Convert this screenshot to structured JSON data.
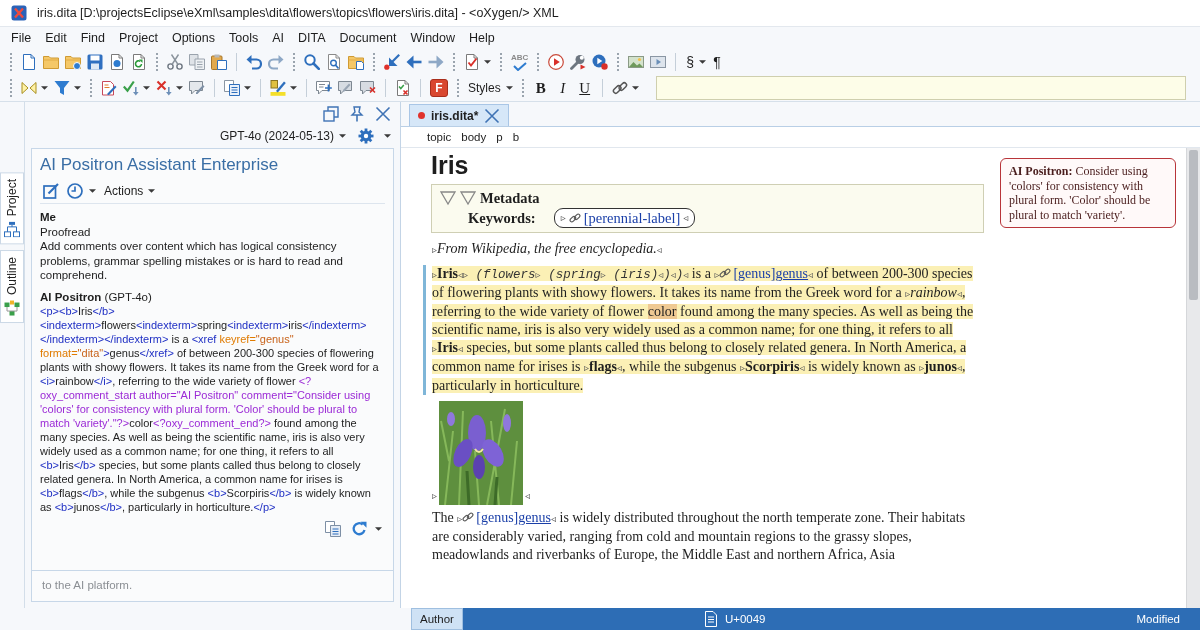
{
  "window": {
    "title": "iris.dita [D:\\projectsEclipse\\eXml\\samples\\dita\\flowers\\topics\\flowers\\iris.dita] - <oXygen/> XML"
  },
  "menu": [
    "File",
    "Edit",
    "Find",
    "Project",
    "Options",
    "Tools",
    "AI",
    "DITA",
    "Document",
    "Window",
    "Help"
  ],
  "toolbar": {
    "spellcheck_label": "ABC",
    "section_sign": "§",
    "pilcrow": "¶",
    "f_label": "F",
    "styles_label": "Styles",
    "format_buttons": [
      "B",
      "I",
      "U"
    ]
  },
  "side_tabs": [
    {
      "label": "Project",
      "selected": false
    },
    {
      "label": "Outline",
      "selected": false
    }
  ],
  "ai_panel": {
    "model": "GPT-4o (2024-05-13)",
    "title": "AI Positron Assistant Enterprise",
    "actions_label": "Actions",
    "messages": [
      {
        "kind": "user",
        "author": "Me",
        "lines": [
          "Proofread",
          "Add comments over content which has logical consistency problems, grammar spelling mistakes or is hard to read and comprehend."
        ]
      },
      {
        "kind": "assistant",
        "author": "AI Positron",
        "model": "(GPT-4o)",
        "code": [
          {
            "kind": "tag",
            "text": "<p><b>"
          },
          {
            "kind": "text",
            "text": "Iris"
          },
          {
            "kind": "tag",
            "text": "</b><indexterm>"
          },
          {
            "kind": "text",
            "text": "flowers"
          },
          {
            "kind": "tag",
            "text": "<indexterm>"
          },
          {
            "kind": "text",
            "text": "spring"
          },
          {
            "kind": "tag",
            "text": "<indexterm>"
          },
          {
            "kind": "text",
            "text": "iris"
          },
          {
            "kind": "tag",
            "text": "</indexterm></indexterm></indexterm>"
          },
          {
            "kind": "text",
            "text": " is a "
          },
          {
            "kind": "tag",
            "text": "<xref "
          },
          {
            "kind": "attr",
            "text": "keyref="
          },
          {
            "kind": "value",
            "text": "\"genus\""
          },
          {
            "kind": "attr",
            "text": " format="
          },
          {
            "kind": "value",
            "text": "\"dita\""
          },
          {
            "kind": "tag",
            "text": ">"
          },
          {
            "kind": "text",
            "text": "genus"
          },
          {
            "kind": "tag",
            "text": "</xref>"
          },
          {
            "kind": "text",
            "text": " of between 200-300 species of flowering plants with showy flowers. It takes its name from the Greek word for a "
          },
          {
            "kind": "tag",
            "text": "<i>"
          },
          {
            "kind": "text",
            "text": "rainbow"
          },
          {
            "kind": "tag",
            "text": "</i>"
          },
          {
            "kind": "text",
            "text": ", referring to the wide variety of flower "
          },
          {
            "kind": "pi",
            "text": "<?oxy_comment_start author=\"AI Positron\" comment=\"Consider using 'colors' for consistency with plural form. 'Color' should be plural to match 'variety'.\"?>"
          },
          {
            "kind": "text",
            "text": "color"
          },
          {
            "kind": "pi",
            "text": "<?oxy_comment_end?>"
          },
          {
            "kind": "text",
            "text": " found among the many species. As well as being the scientific name, iris is also very widely used as a common name; for one thing, it refers to all "
          },
          {
            "kind": "tag",
            "text": "<b>"
          },
          {
            "kind": "text",
            "text": "Iris"
          },
          {
            "kind": "tag",
            "text": "</b>"
          },
          {
            "kind": "text",
            "text": " species, but some plants called thus belong to closely related genera. In North America, a common name for irises is "
          },
          {
            "kind": "tag",
            "text": "<b>"
          },
          {
            "kind": "text",
            "text": "flags"
          },
          {
            "kind": "tag",
            "text": "</b>"
          },
          {
            "kind": "text",
            "text": ", while the subgenus "
          },
          {
            "kind": "tag",
            "text": "<b>"
          },
          {
            "kind": "text",
            "text": "Scorpiris"
          },
          {
            "kind": "tag",
            "text": "</b>"
          },
          {
            "kind": "text",
            "text": " is widely known as "
          },
          {
            "kind": "tag",
            "text": "<b>"
          },
          {
            "kind": "text",
            "text": "junos"
          },
          {
            "kind": "tag",
            "text": "</b>"
          },
          {
            "kind": "text",
            "text": ", particularly in horticulture."
          },
          {
            "kind": "tag",
            "text": "</p>"
          }
        ]
      }
    ],
    "input": {
      "placeholder": "to the AI platform."
    }
  },
  "editor": {
    "tabs": [
      {
        "label": "iris.dita*",
        "selected": true,
        "modified": true
      }
    ],
    "breadcrumb": [
      "topic",
      "body",
      "p",
      "b"
    ],
    "title": "Iris",
    "metadata": {
      "heading": "Metadata",
      "keywords_label": "Keywords:",
      "keyword": {
        "start": "▹",
        "label": "[perennial-label]",
        "end": "◃"
      }
    },
    "blocks": [
      {
        "kind": "paragraph",
        "highlighted": false,
        "segments": [
          {
            "kind": "marker",
            "text": "▹"
          },
          {
            "kind": "italic",
            "text": "From Wikipedia, the free encyclopedia."
          },
          {
            "kind": "marker",
            "text": "◃"
          }
        ]
      },
      {
        "kind": "paragraph",
        "highlighted": true,
        "segments": [
          {
            "kind": "marker",
            "text": "▹"
          },
          {
            "kind": "bold",
            "text": "Iris"
          },
          {
            "kind": "marker",
            "text": "◃▹"
          },
          {
            "kind": "mono",
            "text": " (flowers"
          },
          {
            "kind": "marker",
            "text": "▹"
          },
          {
            "kind": "mono",
            "text": " (spring"
          },
          {
            "kind": "marker",
            "text": "▹"
          },
          {
            "kind": "mono",
            "text": " (iris)"
          },
          {
            "kind": "marker",
            "text": "◃"
          },
          {
            "kind": "mono",
            "text": ")"
          },
          {
            "kind": "marker",
            "text": "◃"
          },
          {
            "kind": "mono",
            "text": ")"
          },
          {
            "kind": "marker",
            "text": "◃"
          },
          {
            "kind": "text",
            "text": " is a "
          },
          {
            "kind": "marker",
            "text": "▹"
          },
          {
            "kind": "link",
            "label": "[genus]",
            "text": "genus"
          },
          {
            "kind": "marker",
            "text": "◃"
          },
          {
            "kind": "text",
            "text": " of between 200-300 species of flowering plants with showy flowers. It takes its name from the Greek word for a "
          },
          {
            "kind": "marker",
            "text": "▹"
          },
          {
            "kind": "italic",
            "text": "rainbow"
          },
          {
            "kind": "marker",
            "text": "◃"
          },
          {
            "kind": "text",
            "text": ", referring to the wide variety of flower "
          },
          {
            "kind": "comment",
            "text": "color"
          },
          {
            "kind": "text",
            "text": " found among the many species. As well as being the scientific name, iris is also very widely used as a common name; for one thing, it refers to all "
          },
          {
            "kind": "marker",
            "text": "▹"
          },
          {
            "kind": "bold",
            "text": "Iris"
          },
          {
            "kind": "marker",
            "text": "◃"
          },
          {
            "kind": "text",
            "text": " species, but some plants called thus belong to closely related genera. In North America, a common name for irises is "
          },
          {
            "kind": "marker",
            "text": "▹"
          },
          {
            "kind": "bold",
            "text": "flags"
          },
          {
            "kind": "marker",
            "text": "◃"
          },
          {
            "kind": "text",
            "text": ", while the subgenus "
          },
          {
            "kind": "marker",
            "text": "▹"
          },
          {
            "kind": "bold",
            "text": "Scorpiris"
          },
          {
            "kind": "marker",
            "text": "◃"
          },
          {
            "kind": "text",
            "text": " is widely known as "
          },
          {
            "kind": "marker",
            "text": "▹"
          },
          {
            "kind": "bold",
            "text": "junos"
          },
          {
            "kind": "marker",
            "text": "◃"
          },
          {
            "kind": "text",
            "text": ", particularly in horticulture."
          }
        ]
      },
      {
        "kind": "image",
        "start_marker": "▹",
        "end_marker": "◃"
      },
      {
        "kind": "paragraph",
        "highlighted": false,
        "segments": [
          {
            "kind": "text",
            "text": "The "
          },
          {
            "kind": "marker",
            "text": "▹"
          },
          {
            "kind": "link",
            "label": "[genus]",
            "text": "genus"
          },
          {
            "kind": "marker",
            "text": "◃"
          },
          {
            "kind": "text",
            "text": " is widely distributed throughout the north temperate zone. Their habitats are considerably varied, ranging from cold and mountain regions to the grassy slopes, meadowlands and riverbanks of Europe, the Middle East and northern Africa, Asia"
          }
        ]
      }
    ],
    "comments": [
      {
        "text": "**AI Positron:** Consider using 'colors' for consistency with plural form. 'Color' should be plural to match 'variety'."
      }
    ],
    "bottom_tabs": [
      {
        "label": "Author",
        "selected": true
      }
    ]
  },
  "status_bar": {
    "character": "U+0049",
    "state": "Modified"
  }
}
